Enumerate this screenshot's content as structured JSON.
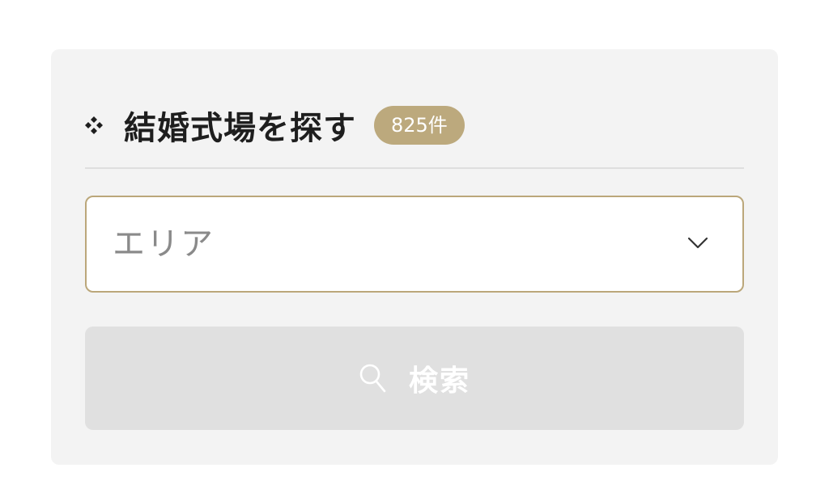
{
  "header": {
    "icon": "diamond-cluster-icon",
    "title": "結婚式場を探す",
    "count_badge": "825件"
  },
  "area_select": {
    "placeholder": "エリア",
    "icon": "chevron-down-icon"
  },
  "search_button": {
    "label": "検索",
    "icon": "search-icon"
  },
  "colors": {
    "panel_bg": "#f3f3f3",
    "accent_gold": "#bca97d",
    "select_border": "#bba77a",
    "button_bg": "#e0e0e0",
    "title_text": "#1e1e1e",
    "placeholder_text": "#8a8a8a"
  }
}
